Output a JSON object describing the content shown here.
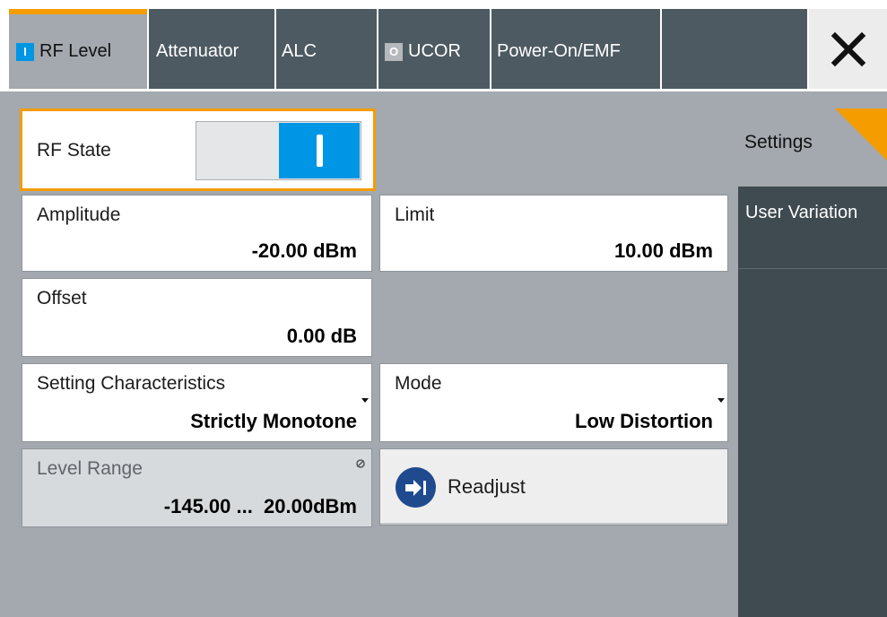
{
  "tabs": [
    {
      "label": "RF Level",
      "indicator": "I",
      "active": true
    },
    {
      "label": "Attenuator"
    },
    {
      "label": "ALC"
    },
    {
      "label": "UCOR",
      "indicator": "O"
    },
    {
      "label": "Power-On/EMF"
    }
  ],
  "close_icon": "close-icon",
  "rf_state": {
    "label": "RF State",
    "on": true
  },
  "amplitude": {
    "label": "Amplitude",
    "value": "-20.00 dBm"
  },
  "limit": {
    "label": "Limit",
    "value": "10.00 dBm"
  },
  "offset": {
    "label": "Offset",
    "value": "0.00 dB"
  },
  "setting_characteristics": {
    "label": "Setting Characteristics",
    "value": "Strictly Monotone"
  },
  "mode": {
    "label": "Mode",
    "value": "Low Distortion"
  },
  "level_range": {
    "label": "Level Range",
    "value": "-145.00 ...  20.00dBm"
  },
  "readjust": {
    "label": "Readjust"
  },
  "side_nav": [
    {
      "label": "Settings",
      "active": true
    },
    {
      "label": "User Variation"
    }
  ],
  "colors": {
    "accent": "#f59c00",
    "on_blue": "#0096e6",
    "tab_dark": "#4d5a62",
    "panel_gray": "#a3a9ae",
    "nav_dark": "#3f4a51"
  }
}
